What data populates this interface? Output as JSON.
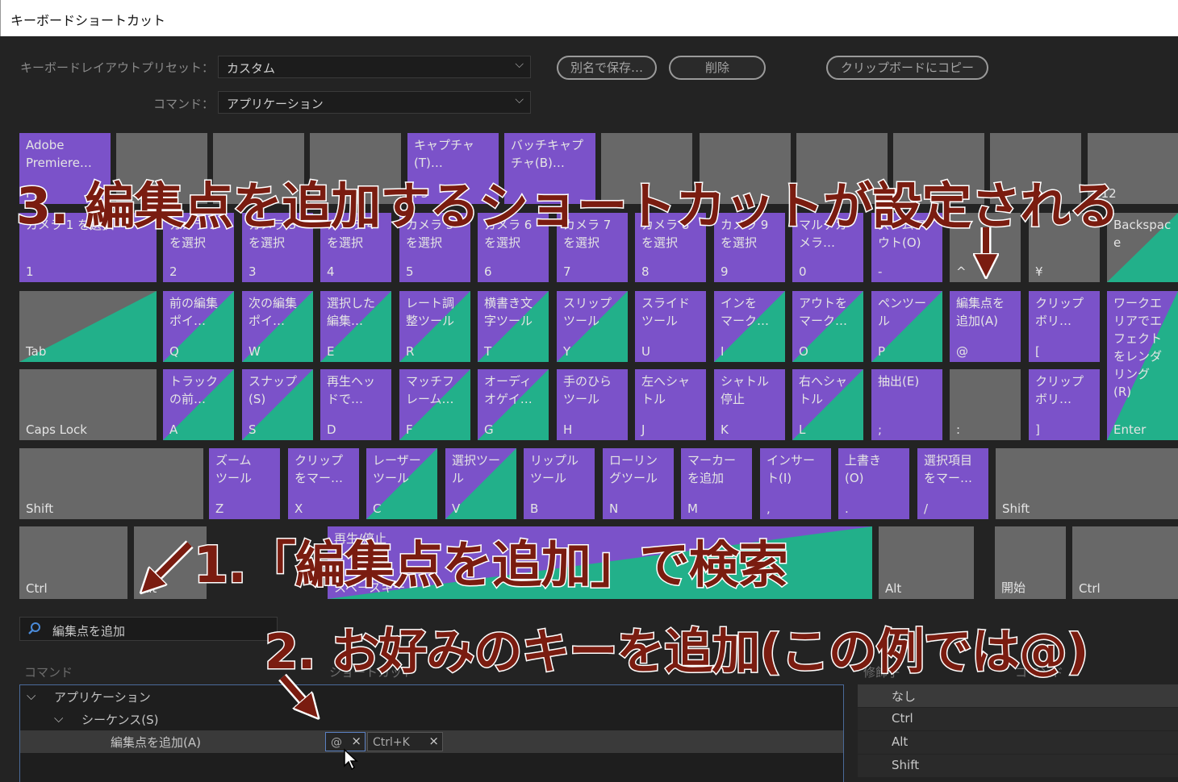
{
  "window": {
    "title": "キーボードショートカット"
  },
  "toolbar": {
    "preset_label": "キーボードレイアウトプリセット：",
    "preset_value": "カスタム",
    "command_label": "コマンド：",
    "command_value": "アプリケーション",
    "save_as_label": "別名で保存…",
    "delete_label": "削除",
    "copy_clipboard_label": "クリップボードにコピー"
  },
  "keyboard": {
    "fn_row": [
      {
        "cmd": "Adobe\nPremiere…",
        "key": "F1"
      },
      {
        "cmd": "",
        "key": ""
      },
      {
        "cmd": "",
        "key": ""
      },
      {
        "cmd": "",
        "key": ""
      },
      {
        "cmd": "キャプチャ\n(T)…",
        "key": "F5"
      },
      {
        "cmd": "バッチキャプ\nチャ(B)…",
        "key": ""
      },
      {
        "cmd": "",
        "key": ""
      },
      {
        "cmd": "",
        "key": ""
      },
      {
        "cmd": "",
        "key": ""
      },
      {
        "cmd": "",
        "key": ""
      },
      {
        "cmd": "",
        "key": "F"
      },
      {
        "cmd": "",
        "key": "F12"
      }
    ],
    "num_row": [
      {
        "cmd": "カメラ 1 を選択",
        "key": "1"
      },
      {
        "cmd": "カメラ 2\nを選択",
        "key": "2"
      },
      {
        "cmd": "カメラ 3\nを選択",
        "key": "3"
      },
      {
        "cmd": "カメラ 4\nを選択",
        "key": "4"
      },
      {
        "cmd": "カメラ 5\nを選択",
        "key": "5"
      },
      {
        "cmd": "カメラ 6\nを選択",
        "key": "6"
      },
      {
        "cmd": "カメラ 7\nを選択",
        "key": "7"
      },
      {
        "cmd": "カメラ 8\nを選択",
        "key": "8"
      },
      {
        "cmd": "カメラ 9\nを選択",
        "key": "9"
      },
      {
        "cmd": "マルチカ\nメラ…",
        "key": "0"
      },
      {
        "cmd": "ズームア\nウト(O)",
        "key": "-"
      },
      {
        "cmd": "",
        "key": "^"
      },
      {
        "cmd": "",
        "key": "¥"
      },
      {
        "cmd": "Backspac\ne",
        "key": ""
      }
    ],
    "q_row": [
      {
        "cmd": "",
        "key": "Tab"
      },
      {
        "cmd": "前の編集\nポイ…",
        "key": "Q"
      },
      {
        "cmd": "次の編集\nポイ…",
        "key": "W"
      },
      {
        "cmd": "選択した\n編集…",
        "key": "E"
      },
      {
        "cmd": "レート調\n整ツール",
        "key": "R"
      },
      {
        "cmd": "横書き文\n字ツール",
        "key": "T"
      },
      {
        "cmd": "スリップ\nツール",
        "key": "Y"
      },
      {
        "cmd": "スライド\nツール",
        "key": "U"
      },
      {
        "cmd": "インを\nマーク…",
        "key": "I"
      },
      {
        "cmd": "アウトを\nマーク…",
        "key": "O"
      },
      {
        "cmd": "ペンツー\nル",
        "key": "P"
      },
      {
        "cmd": "編集点を\n追加(A)",
        "key": "@"
      },
      {
        "cmd": "クリップ\nボリ…",
        "key": "["
      },
      {
        "cmd": "ワークエ\nリアでエ\nフェクト\nをレンダ\nリング\n(R)",
        "key": "Enter"
      }
    ],
    "a_row": [
      {
        "cmd": "",
        "key": "Caps Lock"
      },
      {
        "cmd": "トラック\nの前…",
        "key": "A"
      },
      {
        "cmd": "スナップ\n(S)",
        "key": "S"
      },
      {
        "cmd": "再生ヘッ\nドで…",
        "key": "D"
      },
      {
        "cmd": "マッチフ\nレーム…",
        "key": "F"
      },
      {
        "cmd": "オーディ\nオゲイ…",
        "key": "G"
      },
      {
        "cmd": "手のひら\nツール",
        "key": "H"
      },
      {
        "cmd": "左へシャ\nトル",
        "key": "J"
      },
      {
        "cmd": "シャトル\n停止",
        "key": "K"
      },
      {
        "cmd": "右へシャ\nトル",
        "key": "L"
      },
      {
        "cmd": "抽出(E)",
        "key": ";"
      },
      {
        "cmd": "",
        "key": ":"
      },
      {
        "cmd": "クリップ\nボリ…",
        "key": "]"
      }
    ],
    "z_row": [
      {
        "cmd": "",
        "key": "Shift"
      },
      {
        "cmd": "ズーム\nツール",
        "key": "Z"
      },
      {
        "cmd": "クリップ\nをマー…",
        "key": "X"
      },
      {
        "cmd": "レーザー\nツール",
        "key": "C"
      },
      {
        "cmd": "選択ツー\nル",
        "key": "V"
      },
      {
        "cmd": "リップル\nツール",
        "key": "B"
      },
      {
        "cmd": "ローリン\nグツール",
        "key": "N"
      },
      {
        "cmd": "マーカー\nを追加",
        "key": "M"
      },
      {
        "cmd": "インサー\nト(I)",
        "key": ","
      },
      {
        "cmd": "上書き\n(O)",
        "key": "."
      },
      {
        "cmd": "選択項目\nをマー…",
        "key": "/"
      },
      {
        "cmd": "",
        "key": "Shift"
      }
    ],
    "bottom_row": [
      {
        "cmd": "",
        "key": "Ctrl"
      },
      {
        "cmd": "",
        "key": "Alt"
      },
      {
        "cmd": "再生/停止",
        "key": "スペースキー"
      },
      {
        "cmd": "",
        "key": "Alt"
      },
      {
        "cmd": "",
        "key": "開始"
      },
      {
        "cmd": "",
        "key": "Ctrl"
      }
    ]
  },
  "search": {
    "value": "編集点を追加",
    "icon": "search-icon"
  },
  "columns": {
    "command": "コマンド",
    "shortcut": "ショートカット",
    "modifier": "修飾子",
    "command2": "コマンド"
  },
  "tree": [
    {
      "label": "アプリケーション"
    },
    {
      "label": "シーケンス(S)"
    },
    {
      "label": "編集点を追加(A)"
    }
  ],
  "shortcuts": [
    {
      "label": "@"
    },
    {
      "label": "Ctrl+K"
    }
  ],
  "modifiers": [
    "なし",
    "Ctrl",
    "Alt",
    "Shift"
  ],
  "annotations": {
    "step1": "1.「編集点を追加」で検索",
    "step2": "2. お好みのキーを追加(この例では@)",
    "step3": "3. 編集点を追加するショートカットが設定される"
  },
  "colors": {
    "app_key": "#7b52c9",
    "panel_key": "#22b08a",
    "empty_key": "#686868",
    "annotation": "#7a1c10"
  }
}
